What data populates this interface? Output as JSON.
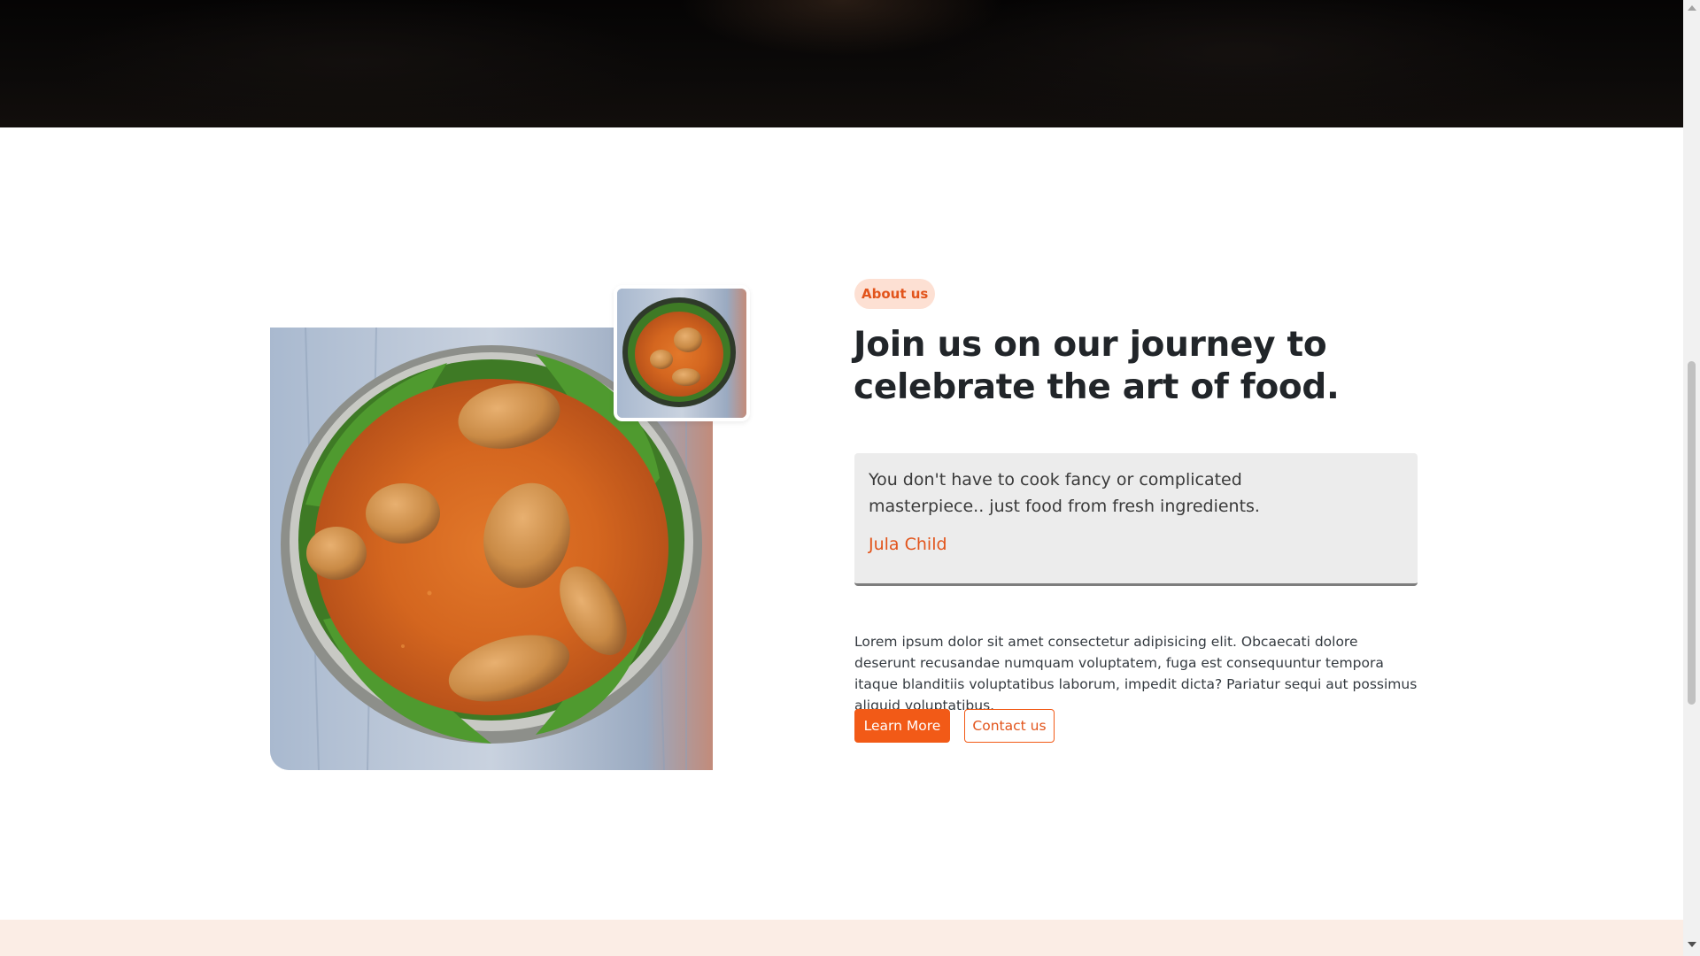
{
  "about": {
    "badge": "About us",
    "headline": "Join us on our journey to celebrate the art of food.",
    "quote": {
      "text": "You don't have to cook fancy or complicated masterpiece.. just food from fresh ingredients.",
      "author": "Jula Child"
    },
    "body": "Lorem ipsum dolor sit amet consectetur adipisicing elit. Obcaecati dolore deserunt recusandae numquam voluptatem, fuga est consequuntur tempora itaque blanditiis voluptatibus laborum, impedit dicta? Pariatur sequi aut possimus aliquid voluptatibus.",
    "buttons": {
      "primary": "Learn More",
      "secondary": "Contact us"
    },
    "images": {
      "main": "jollof-rice-chicken-bowl-image",
      "thumbnail": "jollof-rice-chicken-bowl-thumbnail"
    }
  },
  "colors": {
    "accent": "#f25a17",
    "accent_text": "#e2541b",
    "badge_bg": "#fde0d3",
    "quote_bg": "#ececec",
    "next_section_bg": "#fbede5",
    "heading": "#212529"
  }
}
